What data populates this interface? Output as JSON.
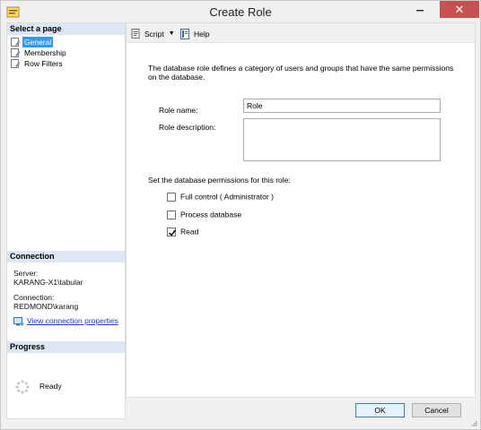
{
  "window": {
    "title": "Create Role",
    "close_glyph": "✕"
  },
  "sidebar": {
    "select_page_header": "Select a page",
    "pages": [
      {
        "label": "General",
        "icon": "wrench-page-icon",
        "selected": true
      },
      {
        "label": "Membership",
        "icon": "wrench-page-icon",
        "selected": false
      },
      {
        "label": "Row Filters",
        "icon": "wrench-page-icon",
        "selected": false
      }
    ],
    "connection_header": "Connection",
    "server_label": "Server:",
    "server_value": "KARANG-X1\\tabular",
    "connection_label": "Connection:",
    "connection_value": "REDMOND\\karang",
    "view_properties_link": "View connection properties",
    "progress_header": "Progress",
    "progress_status": "Ready"
  },
  "toolbar": {
    "script_label": "Script",
    "help_label": "Help"
  },
  "main": {
    "description": "The database role defines a category of users and groups that have the same permissions on the database.",
    "role_name_label": "Role name:",
    "role_name_value": "Role",
    "role_description_label": "Role description:",
    "role_description_value": "",
    "permissions_label": "Set the database permissions for this role:",
    "permissions": [
      {
        "label": "Full control ( Administrator )",
        "checked": false
      },
      {
        "label": "Process database",
        "checked": false
      },
      {
        "label": "Read",
        "checked": true
      }
    ]
  },
  "buttons": {
    "ok_label": "OK",
    "cancel_label": "Cancel"
  },
  "colors": {
    "selection": "#3399ff",
    "section_header": "#dce6f4",
    "close_button": "#c75050",
    "link": "#1a3ccc"
  }
}
